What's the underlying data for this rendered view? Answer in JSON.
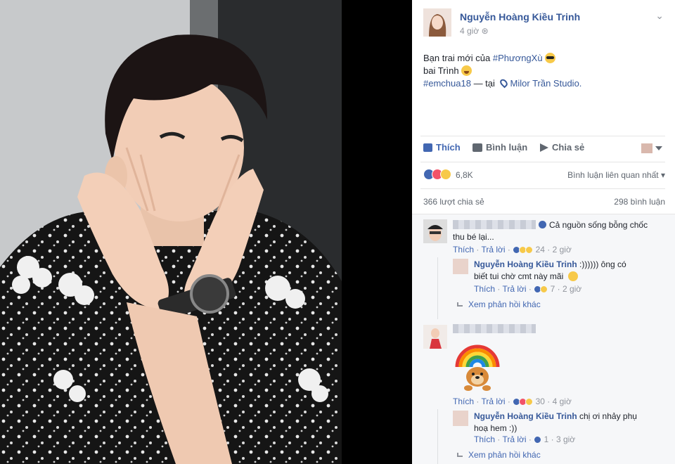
{
  "post": {
    "author": "Nguyễn Hoàng Kiều Trinh",
    "time": "4 giờ",
    "line1": "Bạn trai mới của ",
    "hashtag1": "#PhươngXù",
    "line2": "bai Trình",
    "hashtag2": "#emchua18",
    "at_text": " — tại ",
    "place": "Milor Trần Studio."
  },
  "actions": {
    "like": "Thích",
    "comment": "Bình luận",
    "share": "Chia sẻ"
  },
  "stats": {
    "reactions": "6,8K",
    "relevant": "Bình luận liên quan nhất",
    "shares": "366 lượt chia sẻ",
    "comments": "298 bình luận"
  },
  "comments": [
    {
      "text": "Cả nguồn sống bỗng chốc",
      "text2": "thu bé lại...",
      "like": "Thích",
      "reply": "Trả lời",
      "count": "24",
      "time": "2 giờ",
      "reply_item": {
        "author": "Nguyễn Hoàng Kiều Trinh",
        "text": " :)))))) ông có",
        "text2": "biết tui chờ cmt này mãi",
        "like": "Thích",
        "reply": "Trả lời",
        "count": "7",
        "time": "2 giờ"
      },
      "more": "Xem phản hồi khác"
    },
    {
      "like": "Thích",
      "reply": "Trả lời",
      "count": "30",
      "time": "4 giờ",
      "reply_item": {
        "author": "Nguyễn Hoàng Kiều Trinh",
        "text": " chị ơi nhảy phụ",
        "text2": "hoạ hem :))",
        "like": "Thích",
        "reply": "Trả lời",
        "count": "1",
        "time": "3 giờ"
      },
      "more": "Xem phản hồi khác"
    }
  ],
  "colors": {
    "link": "#365899",
    "accent": "#4267b2",
    "muted": "#90949c"
  }
}
